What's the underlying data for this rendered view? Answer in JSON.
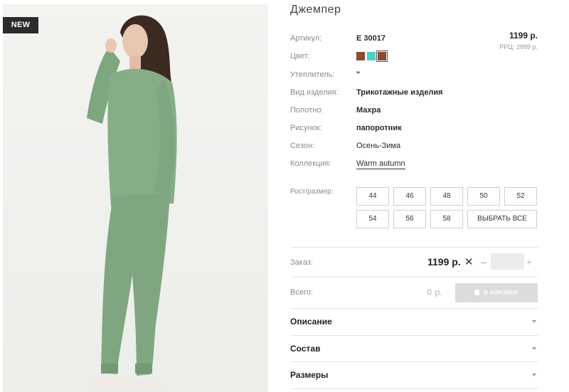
{
  "badge": "NEW",
  "product": {
    "title": "Джемпер",
    "price": "1199 р.",
    "rrp": "РРЦ: 2999 р."
  },
  "attributes": [
    {
      "label": "Артикул:",
      "value": "E 30017"
    },
    {
      "label": "Цвет:",
      "value": ""
    },
    {
      "label": "Утеплитель:",
      "value": "\""
    },
    {
      "label": "Вид изделия:",
      "value": "Трикотажные изделия"
    },
    {
      "label": "Полотно:",
      "value": "Махра"
    },
    {
      "label": "Рисунок:",
      "value": "папоротник"
    },
    {
      "label": "Сезон:",
      "value": "Осень-Зима"
    },
    {
      "label": "Коллекция:",
      "value": "Warm autumn"
    }
  ],
  "colors": [
    {
      "name": "brown",
      "hex": "#8b4a32",
      "selected": false
    },
    {
      "name": "turquoise",
      "hex": "#4fd0c4",
      "selected": false
    },
    {
      "name": "brown",
      "hex": "#8b4a32",
      "selected": true
    }
  ],
  "sizes": {
    "label": "Рост/размер:",
    "options": [
      "44",
      "46",
      "48",
      "50",
      "52",
      "54",
      "56",
      "58"
    ],
    "select_all": "ВЫБРАТЬ ВСЕ"
  },
  "order": {
    "label": "Заказ:",
    "price": "1199 р.",
    "times": "✕",
    "minus": "–",
    "plus": "+",
    "quantity": ""
  },
  "total": {
    "label": "Всего:",
    "value": "0 р.",
    "cart_button": "В КОРЗИНУ"
  },
  "accordion": [
    "Описание",
    "Состав",
    "Размеры"
  ]
}
